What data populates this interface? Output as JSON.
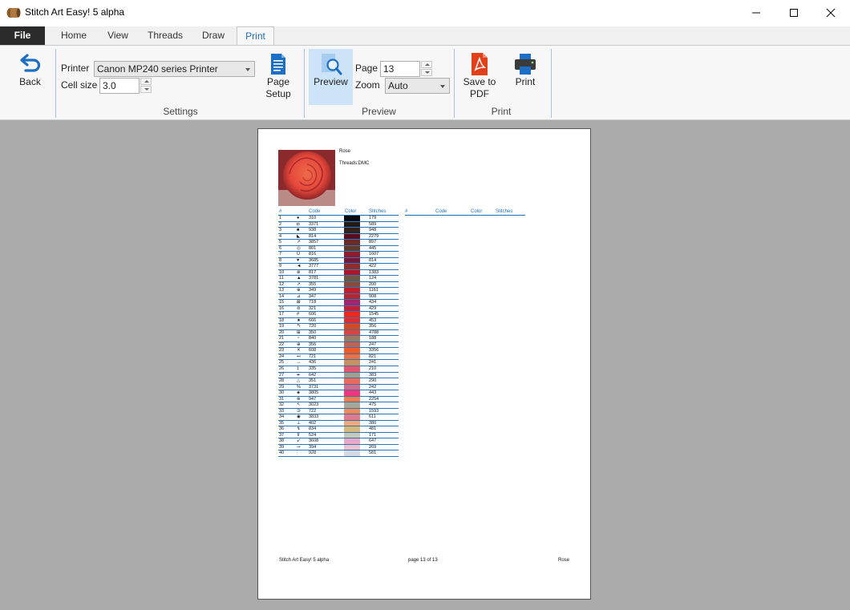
{
  "window": {
    "title": "Stitch Art Easy! 5 alpha"
  },
  "tabs": [
    "File",
    "Home",
    "View",
    "Threads",
    "Draw",
    "Print"
  ],
  "ribbon": {
    "back_label": "Back",
    "printer_label": "Printer",
    "printer_value": "Canon MP240 series Printer",
    "cell_size_label": "Cell size",
    "cell_size_value": "3.0",
    "page_setup_line1": "Page",
    "page_setup_line2": "Setup",
    "settings_group": "Settings",
    "preview_label": "Preview",
    "page_label": "Page",
    "page_value": "13",
    "zoom_label": "Zoom",
    "zoom_value": "Auto",
    "preview_group": "Preview",
    "save_pdf_line1": "Save to",
    "save_pdf_line2": "PDF",
    "print_label": "Print",
    "print_group": "Print"
  },
  "document": {
    "name": "Rose",
    "threads": "Threads:DMC",
    "headers": [
      "#",
      "Code",
      "Color",
      "Stitches"
    ],
    "footer_left": "Stitch Art Easy! 5 alpha",
    "footer_center": "page 13 of 13",
    "footer_right": "Rose",
    "rows": [
      {
        "n": "1",
        "sym": "●",
        "code": "310",
        "color": "#0b0b0e",
        "st": "179"
      },
      {
        "n": "2",
        "sym": "◘",
        "code": "3371",
        "color": "#231915",
        "st": "589"
      },
      {
        "n": "3",
        "sym": "■",
        "code": "938",
        "color": "#33201a",
        "st": "948"
      },
      {
        "n": "4",
        "sym": "◣",
        "code": "814",
        "color": "#5c0c1c",
        "st": "2279"
      },
      {
        "n": "5",
        "sym": "↗",
        "code": "3857",
        "color": "#6b2a24",
        "st": "897"
      },
      {
        "n": "6",
        "sym": "◎",
        "code": "801",
        "color": "#5e3a27",
        "st": "445"
      },
      {
        "n": "7",
        "sym": "Ü",
        "code": "816",
        "color": "#8e1b2d",
        "st": "1607"
      },
      {
        "n": "8",
        "sym": "♥",
        "code": "3685",
        "color": "#74173a",
        "st": "814"
      },
      {
        "n": "9",
        "sym": "◄",
        "code": "3777",
        "color": "#8f2d2b",
        "st": "422"
      },
      {
        "n": "10",
        "sym": "⊗",
        "code": "817",
        "color": "#b01426",
        "st": "1383"
      },
      {
        "n": "11",
        "sym": "▲",
        "code": "3781",
        "color": "#6d5845",
        "st": "124"
      },
      {
        "n": "12",
        "sym": "↗",
        "code": "355",
        "color": "#8b4a35",
        "st": "200"
      },
      {
        "n": "13",
        "sym": "⊕",
        "code": "349",
        "color": "#c31c2a",
        "st": "1161"
      },
      {
        "n": "14",
        "sym": "⊿",
        "code": "347",
        "color": "#b3262e",
        "st": "908"
      },
      {
        "n": "15",
        "sym": "⊠",
        "code": "718",
        "color": "#a2256b",
        "st": "434"
      },
      {
        "n": "16",
        "sym": "⊜",
        "code": "321",
        "color": "#c62035",
        "st": "429"
      },
      {
        "n": "17",
        "sym": "#",
        "code": "606",
        "color": "#f2261a",
        "st": "1545"
      },
      {
        "n": "18",
        "sym": "★",
        "code": "666",
        "color": "#e32a2e",
        "st": "453"
      },
      {
        "n": "19",
        "sym": "↰",
        "code": "720",
        "color": "#d44a22",
        "st": "356"
      },
      {
        "n": "20",
        "sym": "⊞",
        "code": "350",
        "color": "#e0423a",
        "st": "4788"
      },
      {
        "n": "21",
        "sym": "◔",
        "code": "840",
        "color": "#9a7a62",
        "st": "188"
      },
      {
        "n": "22",
        "sym": "⊕",
        "code": "356",
        "color": "#c46450",
        "st": "247"
      },
      {
        "n": "23",
        "sym": "✕",
        "code": "608",
        "color": "#f65a26",
        "st": "3356"
      },
      {
        "n": "24",
        "sym": "↤",
        "code": "721",
        "color": "#f27142",
        "st": "821"
      },
      {
        "n": "25",
        "sym": "↔",
        "code": "436",
        "color": "#c8915f",
        "st": "241"
      },
      {
        "n": "26",
        "sym": "‡",
        "code": "335",
        "color": "#e65570",
        "st": "210"
      },
      {
        "n": "27",
        "sym": "↞",
        "code": "642",
        "color": "#a89c86",
        "st": "383"
      },
      {
        "n": "28",
        "sym": "△",
        "code": "351",
        "color": "#ec6a5c",
        "st": "290"
      },
      {
        "n": "29",
        "sym": "%",
        "code": "3731",
        "color": "#d76b86",
        "st": "242"
      },
      {
        "n": "30",
        "sym": "◈",
        "code": "3805",
        "color": "#f0357a",
        "st": "443"
      },
      {
        "n": "31",
        "sym": "⊗",
        "code": "947",
        "color": "#ff7b4a",
        "st": "2254"
      },
      {
        "n": "32",
        "sym": "↖",
        "code": "3023",
        "color": "#a8a695",
        "st": "475"
      },
      {
        "n": "33",
        "sym": "∋",
        "code": "722",
        "color": "#f78955",
        "st": "1593"
      },
      {
        "n": "34",
        "sym": "◉",
        "code": "3833",
        "color": "#e27a8e",
        "st": "611"
      },
      {
        "n": "35",
        "sym": "⊥",
        "code": "402",
        "color": "#f2a777",
        "st": "380"
      },
      {
        "n": "36",
        "sym": "↯",
        "code": "834",
        "color": "#d6b87a",
        "st": "481"
      },
      {
        "n": "37",
        "sym": "⊽",
        "code": "524",
        "color": "#c5c8b4",
        "st": "171"
      },
      {
        "n": "38",
        "sym": "↙",
        "code": "3608",
        "color": "#e8a8c8",
        "st": "647"
      },
      {
        "n": "39",
        "sym": "⊸",
        "code": "394",
        "color": "#f0c0cc",
        "st": "269"
      },
      {
        "n": "40",
        "sym": "∶",
        "code": "928",
        "color": "#d4dbe2",
        "st": "581"
      }
    ]
  }
}
